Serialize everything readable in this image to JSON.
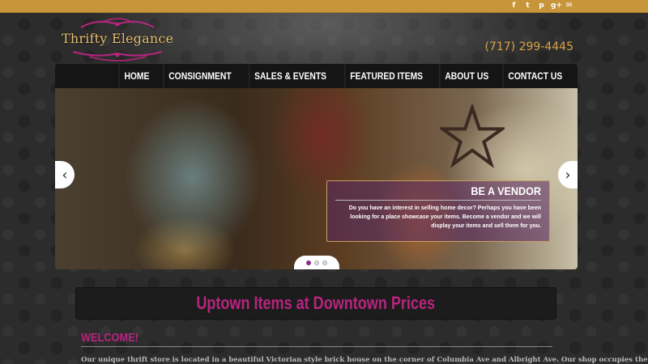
{
  "header": {
    "logo_text": "Thrifty Elegance",
    "phone": "(717) 299-4445",
    "social_icons": [
      "facebook-icon",
      "twitter-icon",
      "pinterest-icon",
      "google-plus-icon",
      "email-icon"
    ],
    "social_glyphs": [
      "f",
      "t",
      "p",
      "g+",
      "✉"
    ]
  },
  "nav": {
    "items": [
      "HOME",
      "CONSIGNMENT",
      "SALES & EVENTS",
      "FEATURED ITEMS",
      "ABOUT US",
      "CONTACT US"
    ]
  },
  "slider": {
    "caption_title": "BE A VENDOR",
    "caption_text": "Do you have an interest in selling home decor? Perhaps you have been looking for a place showcase your items. Become a vendor and we will display your items and sell them for you.",
    "prev": "‹",
    "next": "›",
    "active_slide": 1,
    "slide_count": 3
  },
  "tagline": "Uptown Items at Downtown Prices",
  "welcome": {
    "heading": "WELCOME!",
    "text": "Our unique thrift store is located in a beautiful Victorian style brick house on the corner of Columbia Ave and Albright Ave. Our shop occupies the entire"
  },
  "colors": {
    "topbar": "#c8963a",
    "accent": "#b8247f",
    "phone": "#d9a345"
  }
}
